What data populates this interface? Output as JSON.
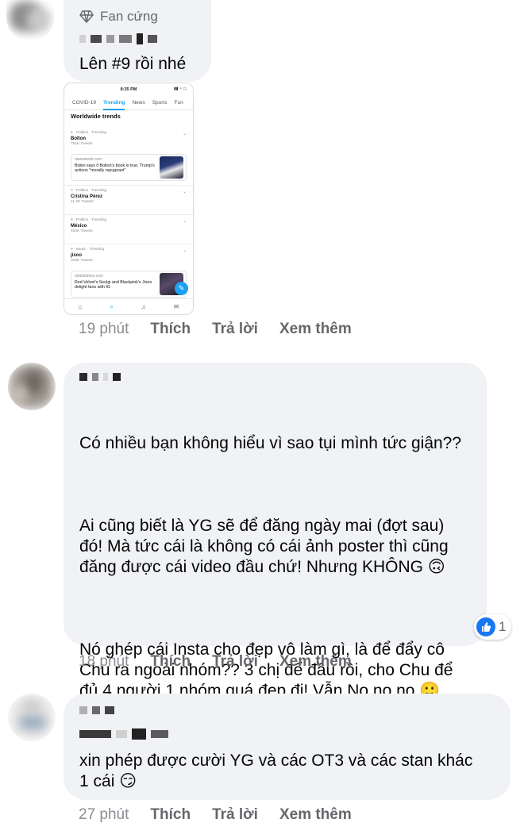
{
  "comments": [
    {
      "badge": "Fan cứng",
      "text": "Lên #9 rồi nhé",
      "time": "19 phút",
      "actions": [
        "Thích",
        "Trả lời",
        "Xem thêm"
      ]
    },
    {
      "paragraphs": [
        "Có nhiều bạn không hiểu vì sao tụi mình tức giận??",
        "Ai cũng biết là YG sẽ để đăng ngày mai (đợt sau) đó! Mà tức cái là không có cái ảnh poster thì cũng đăng được cái video đầu chứ! Nhưng KHÔNG 🙃",
        "Nó ghép cái Insta cho đẹp vô làm gì, là để đẩy cô Chu ra ngoài nhóm?? 3 chị để đầu rồi, cho Chu để đủ 4 người 1 nhóm quá đẹp đi! Vẫn No no no 🙂"
      ],
      "reaction_count": "1",
      "time": "18 phút",
      "actions": [
        "Thích",
        "Trả lời",
        "Xem thêm"
      ]
    },
    {
      "text": "xin phép được cười YG và các OT3 và các stan khác 1 cái 😏",
      "time": "27 phút",
      "actions": [
        "Thích",
        "Trả lời",
        "Xem thêm"
      ]
    }
  ],
  "screenshot": {
    "clock": "8:35 PM",
    "tabs": [
      "COVID-19",
      "Trending",
      "News",
      "Sports",
      "Fun"
    ],
    "active_tab": "Trending",
    "heading": "Worldwide trends",
    "trends": [
      {
        "category": "6 · Politics · Trending",
        "name": "Bolton",
        "tweets": "751K Tweets"
      },
      {
        "category": "7 · Politics · Trending",
        "name": "Cristina Pérez",
        "tweets": "11.3K Tweets"
      },
      {
        "category": "8 · Politics · Trending",
        "name": "México",
        "tweets": "463K Tweets"
      },
      {
        "category": "9 · Music · Trending",
        "name": "jisoo",
        "tweets": "343K Tweets"
      }
    ],
    "cards": [
      {
        "source": "newsweek.com",
        "title": "Biden says if Bolton's book is true, Trump's actions \"morally repugnant\""
      },
      {
        "source": "straitstimes.com",
        "title": "Red Velvet's Seulgi and Blackpink's Jisoo delight fans with IG"
      }
    ]
  },
  "colors": {
    "bubble": "#f0f2f5",
    "meta_text": "#65676b",
    "like_blue": "#1877f2",
    "twitter_blue": "#1da1f2"
  }
}
